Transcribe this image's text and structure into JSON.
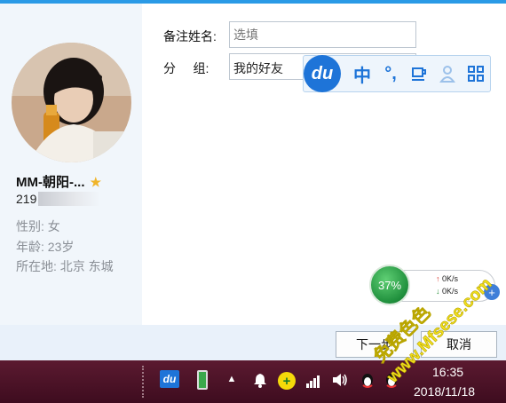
{
  "profile": {
    "name": "MM-朝阳-...",
    "qq_prefix": "219",
    "gender_label": "性别:",
    "gender_value": "女",
    "age_label": "年龄:",
    "age_value": "23岁",
    "location_label": "所在地:",
    "location_value": "北京  东城"
  },
  "form": {
    "remark_label": "备注姓名:",
    "remark_placeholder": "选填",
    "group_label": "分     组:",
    "group_value": "我的好友"
  },
  "ime": {
    "logo": "du",
    "mode": "中",
    "punct": "°,",
    "items": [
      "du-logo",
      "chinese-mode",
      "punctuation",
      "cup-icon",
      "user-icon",
      "grid-icon"
    ]
  },
  "speed": {
    "percent": "37%",
    "upload": "0K/s",
    "download": "0K/s"
  },
  "buttons": {
    "next": "下一步",
    "cancel": "取消"
  },
  "taskbar": {
    "time": "16:35",
    "date": "2018/11/18",
    "du_label": "du"
  },
  "watermark": {
    "cn": "免费色色",
    "url": "www.Mfsese.com"
  },
  "colors": {
    "accent": "#2a9ae6",
    "taskbar": "#4a1226",
    "ime_blue": "#1e74d8",
    "speed_green": "#2a9a45"
  }
}
